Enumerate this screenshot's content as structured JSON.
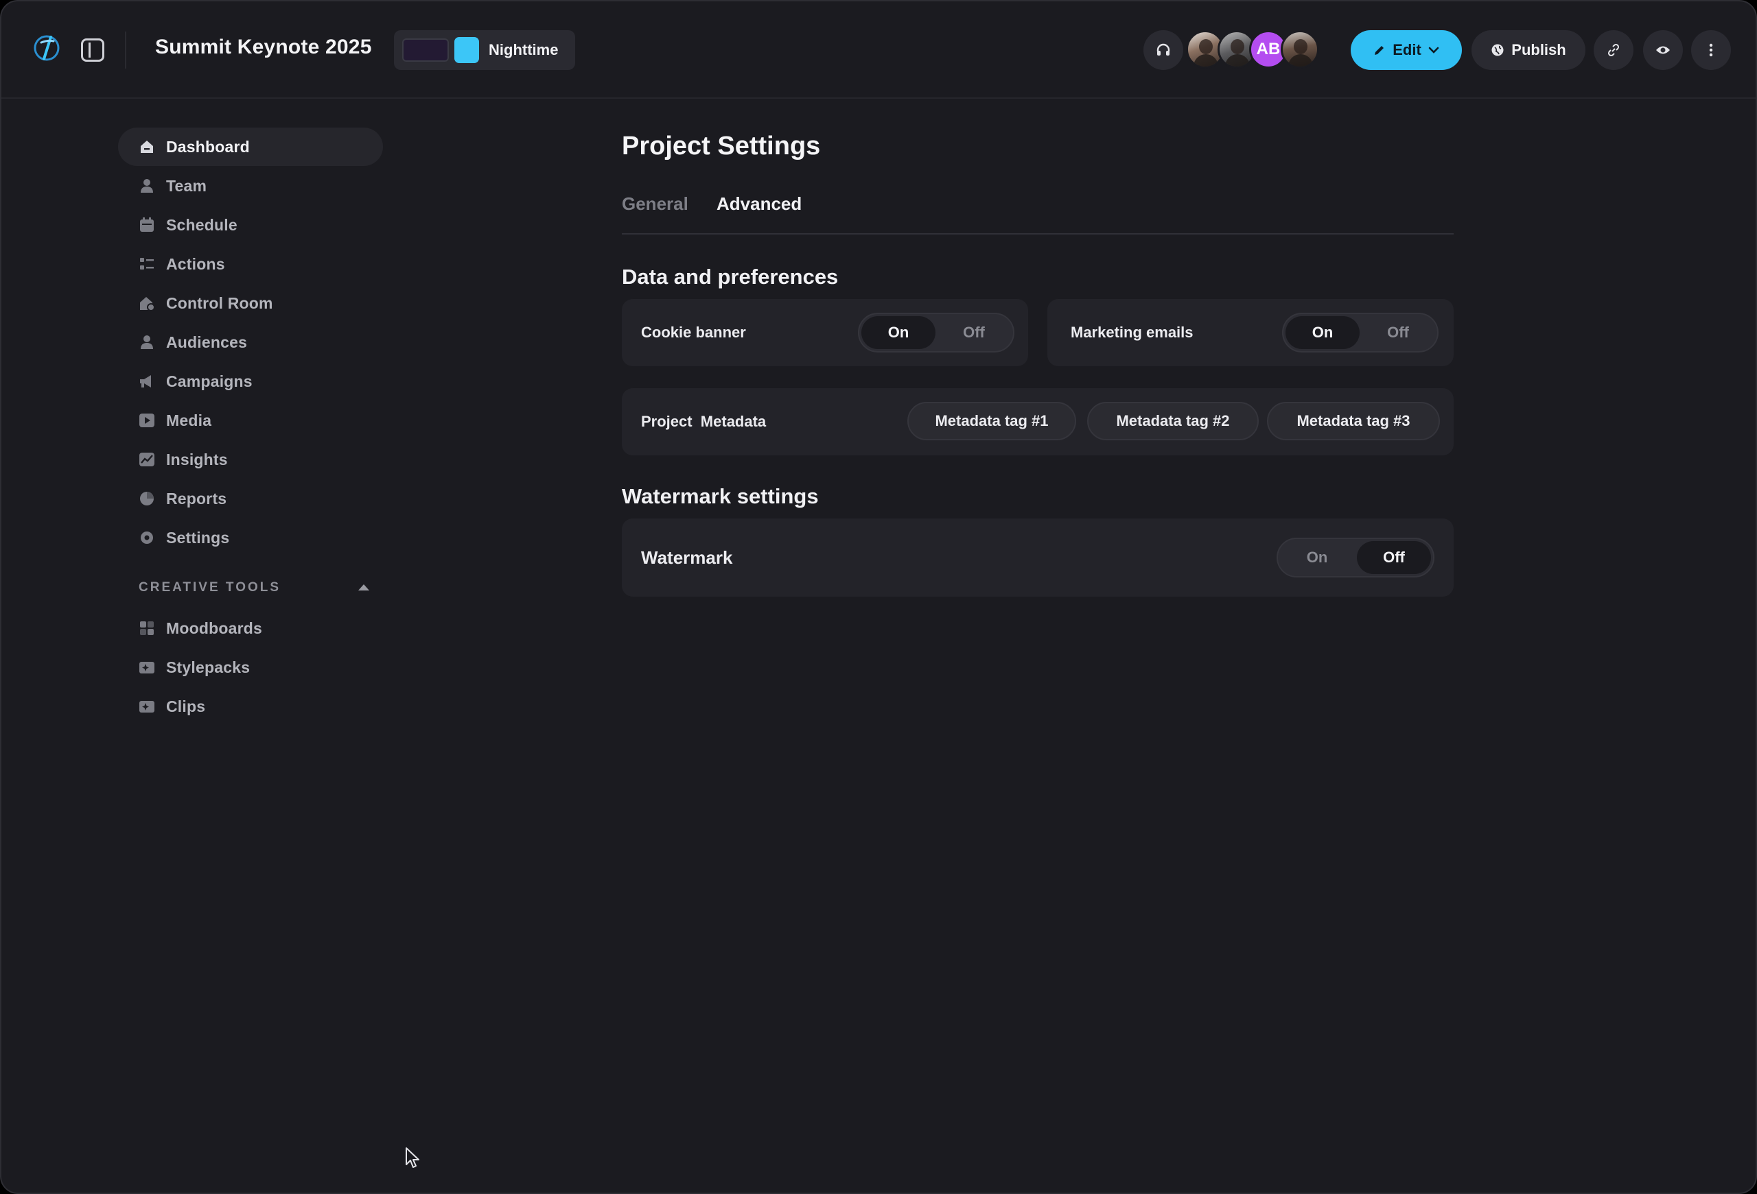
{
  "header": {
    "project_title": "Summit Keynote 2025",
    "theme": {
      "label": "Nighttime",
      "swatch_dark": "#231a33",
      "swatch_accent": "#3cc6f7"
    },
    "avatars": [
      {
        "initials": ""
      },
      {
        "initials": ""
      },
      {
        "initials": "AB",
        "color": "#b44df0"
      },
      {
        "initials": ""
      }
    ],
    "edit_label": "Edit",
    "publish_label": "Publish",
    "accent": "#30bff3"
  },
  "sidebar": {
    "items": [
      {
        "label": "Dashboard",
        "icon": "home-icon"
      },
      {
        "label": "Team",
        "icon": "user-icon"
      },
      {
        "label": "Schedule",
        "icon": "calendar-icon"
      },
      {
        "label": "Actions",
        "icon": "checklist-icon"
      },
      {
        "label": "Control Room",
        "icon": "control-room-icon"
      },
      {
        "label": "Audiences",
        "icon": "audience-icon"
      },
      {
        "label": "Campaigns",
        "icon": "megaphone-icon"
      },
      {
        "label": "Media",
        "icon": "play-icon"
      },
      {
        "label": "Insights",
        "icon": "chart-icon"
      },
      {
        "label": "Reports",
        "icon": "pie-icon"
      },
      {
        "label": "Settings",
        "icon": "gear-icon"
      }
    ],
    "creative_tools": {
      "label": "CREATIVE TOOLS",
      "items": [
        {
          "label": "Moodboards",
          "icon": "grid-icon"
        },
        {
          "label": "Stylepacks",
          "icon": "sparkle-image-icon"
        },
        {
          "label": "Clips",
          "icon": "clip-icon"
        }
      ]
    }
  },
  "main": {
    "title": "Project Settings",
    "tabs": [
      {
        "label": "General"
      },
      {
        "label": "Advanced"
      }
    ],
    "data_section": {
      "title": "Data and preferences",
      "cookie": {
        "label": "Cookie banner",
        "on": "On",
        "off": "Off",
        "value": "On"
      },
      "marketing": {
        "label": "Marketing emails",
        "on": "On",
        "off": "Off",
        "value": "On"
      },
      "metadata": {
        "label": "Project  Metadata",
        "tags": [
          "Metadata tag #1",
          "Metadata tag #2",
          "Metadata tag #3"
        ]
      }
    },
    "watermark_section": {
      "title": "Watermark settings",
      "watermark": {
        "label": "Watermark",
        "on": "On",
        "off": "Off",
        "value": "Off"
      }
    }
  }
}
